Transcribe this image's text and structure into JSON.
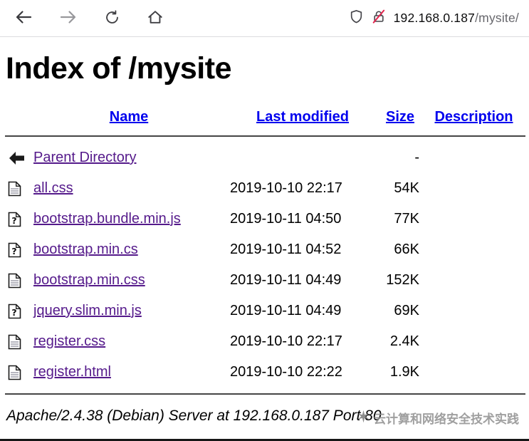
{
  "browser": {
    "url_host": "192.168.0.187",
    "url_path": "/mysite/",
    "icons": {
      "back": "back-arrow-icon",
      "forward": "forward-arrow-icon",
      "refresh": "refresh-icon",
      "home": "home-icon",
      "shield": "tracking-protection-shield-icon",
      "insecure": "insecure-lock-strikethrough-icon"
    }
  },
  "page": {
    "title": "Index of /mysite",
    "columns": {
      "name": "Name",
      "last_modified": "Last modified",
      "size": "Size",
      "description": "Description"
    },
    "rows": [
      {
        "icon": "back",
        "name": "Parent Directory",
        "modified": "",
        "size": "-",
        "description": ""
      },
      {
        "icon": "text",
        "name": "all.css",
        "modified": "2019-10-10 22:17",
        "size": "54K",
        "description": ""
      },
      {
        "icon": "unknown",
        "name": "bootstrap.bundle.min.js",
        "modified": "2019-10-11 04:50",
        "size": "77K",
        "description": ""
      },
      {
        "icon": "unknown",
        "name": "bootstrap.min.cs",
        "modified": "2019-10-11 04:52",
        "size": "66K",
        "description": ""
      },
      {
        "icon": "text",
        "name": "bootstrap.min.css",
        "modified": "2019-10-11 04:49",
        "size": "152K",
        "description": ""
      },
      {
        "icon": "unknown",
        "name": "jquery.slim.min.js",
        "modified": "2019-10-11 04:49",
        "size": "69K",
        "description": ""
      },
      {
        "icon": "text",
        "name": "register.css",
        "modified": "2019-10-10 22:17",
        "size": "2.4K",
        "description": ""
      },
      {
        "icon": "text",
        "name": "register.html",
        "modified": "2019-10-10 22:22",
        "size": "1.9K",
        "description": ""
      }
    ],
    "footer": "Apache/2.4.38 (Debian) Server at 192.168.0.187 Port 80",
    "watermark": "云计算和网络安全技术实践"
  },
  "colors": {
    "header_link": "#0000EE",
    "visited_link": "#551A8B",
    "insecure_strike": "#E22850"
  }
}
